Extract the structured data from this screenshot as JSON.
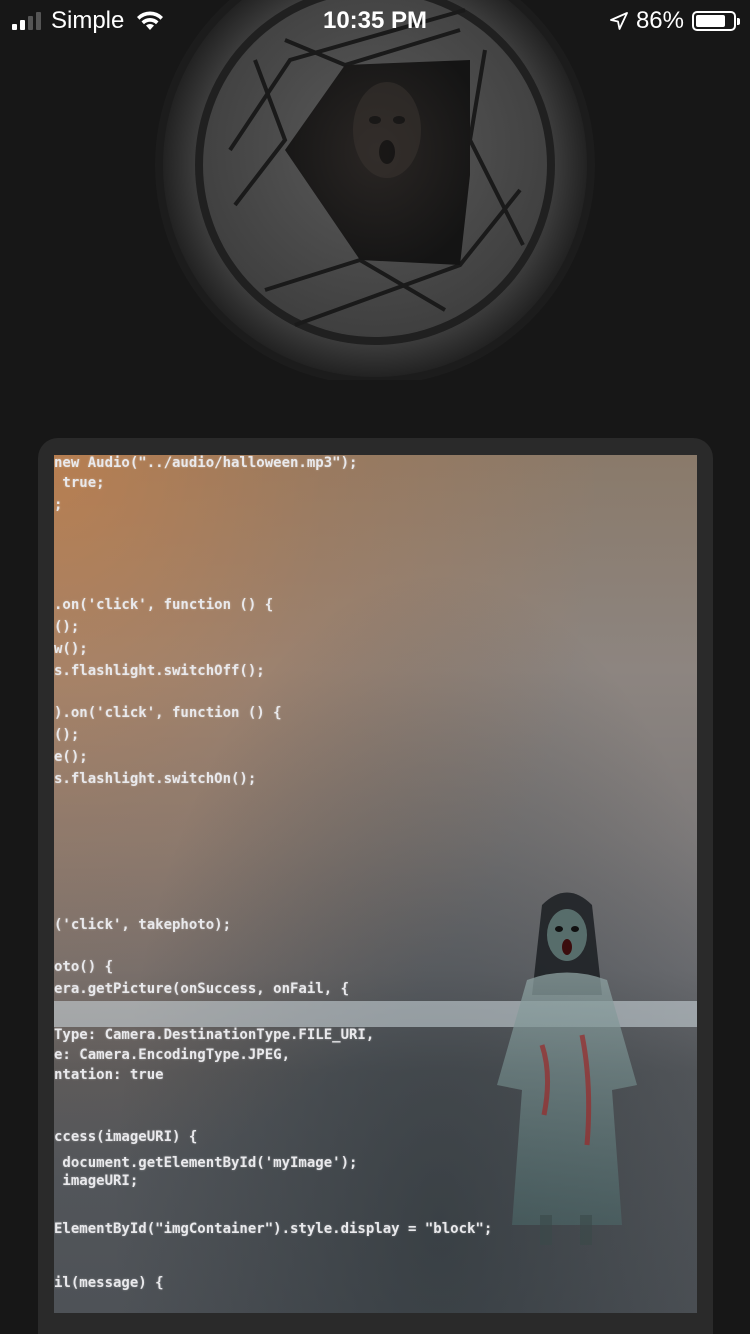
{
  "status_bar": {
    "carrier": "Simple",
    "time": "10:35 PM",
    "battery_percent": "86%",
    "battery_level": 0.86,
    "signal_bars_active": 2,
    "signal_bars_total": 4
  },
  "shutter": {
    "icon": "camera-shutter-icon"
  },
  "photo": {
    "code_lines": [
      "new Audio(\"../audio/halloween.mp3\");",
      " true;",
      ";",
      ".on('click', function () {",
      "();",
      "w();",
      "s.flashlight.switchOff();",
      ").on('click', function () {",
      "();",
      "e();",
      "s.flashlight.switchOn();",
      "",
      "('click', takephoto);",
      "oto() {",
      "era.getPicture(onSuccess, onFail, {",
      "Type: Camera.DestinationType.FILE_URI,",
      "e: Camera.EncodingType.JPEG,",
      "ntation: true",
      "ccess(imageURI) {",
      " document.getElementById('myImage');",
      " imageURI;",
      "ElementById(\"imgContainer\").style.display = \"block\";",
      "il(message) {"
    ]
  },
  "colors": {
    "background": "#171717",
    "card": "#2a2a2a"
  }
}
